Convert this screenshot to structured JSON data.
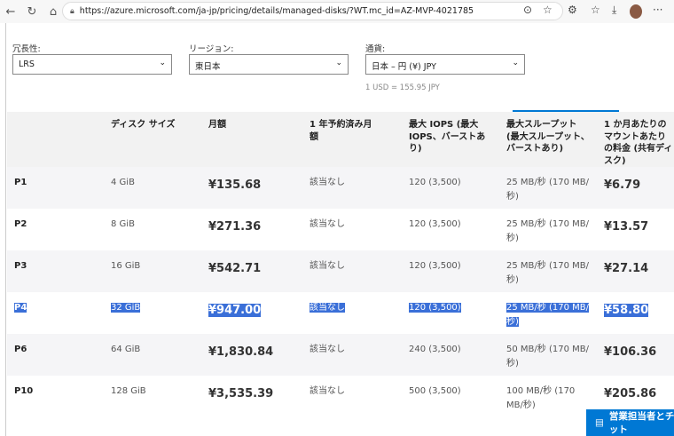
{
  "browser": {
    "url": "https://azure.microsoft.com/ja-jp/pricing/details/managed-disks/?WT.mc_id=AZ-MVP-4021785"
  },
  "filters": {
    "redundancy_label": "冗長性:",
    "redundancy_value": "LRS",
    "region_label": "リージョン:",
    "region_value": "東日本",
    "currency_label": "通貨:",
    "currency_value": "日本 – 円 (¥) JPY",
    "rate": "1 USD = 155.95 JPY"
  },
  "table": {
    "headers": [
      "",
      "ディスク サイズ",
      "月額",
      "1 年予約済み月額",
      "最大 IOPS (最大 IOPS、バーストあり)",
      "最大スループット (最大スループット、バーストあり)",
      "1 か月あたりのマウントあたりの料金 (共有ディスク)"
    ],
    "rows": [
      [
        "P1",
        "4 GiB",
        "¥135.68",
        "該当なし",
        "120 (3,500)",
        "25 MB/秒 (170 MB/秒)",
        "¥6.79"
      ],
      [
        "P2",
        "8 GiB",
        "¥271.36",
        "該当なし",
        "120 (3,500)",
        "25 MB/秒 (170 MB/秒)",
        "¥13.57"
      ],
      [
        "P3",
        "16 GiB",
        "¥542.71",
        "該当なし",
        "120 (3,500)",
        "25 MB/秒 (170 MB/秒)",
        "¥27.14"
      ],
      [
        "P4",
        "32 GiB",
        "¥947.00",
        "該当なし",
        "120 (3,500)",
        "25 MB/秒 (170 MB/秒)",
        "¥58.80"
      ],
      [
        "P6",
        "64 GiB",
        "¥1,830.84",
        "該当なし",
        "240 (3,500)",
        "50 MB/秒 (170 MB/秒)",
        "¥106.36"
      ],
      [
        "P10",
        "128 GiB",
        "¥3,535.39",
        "該当なし",
        "500 (3,500)",
        "100 MB/秒 (170 MB/秒)",
        "¥205.86"
      ]
    ]
  },
  "chat": {
    "label": "営業担当者とチャット"
  }
}
